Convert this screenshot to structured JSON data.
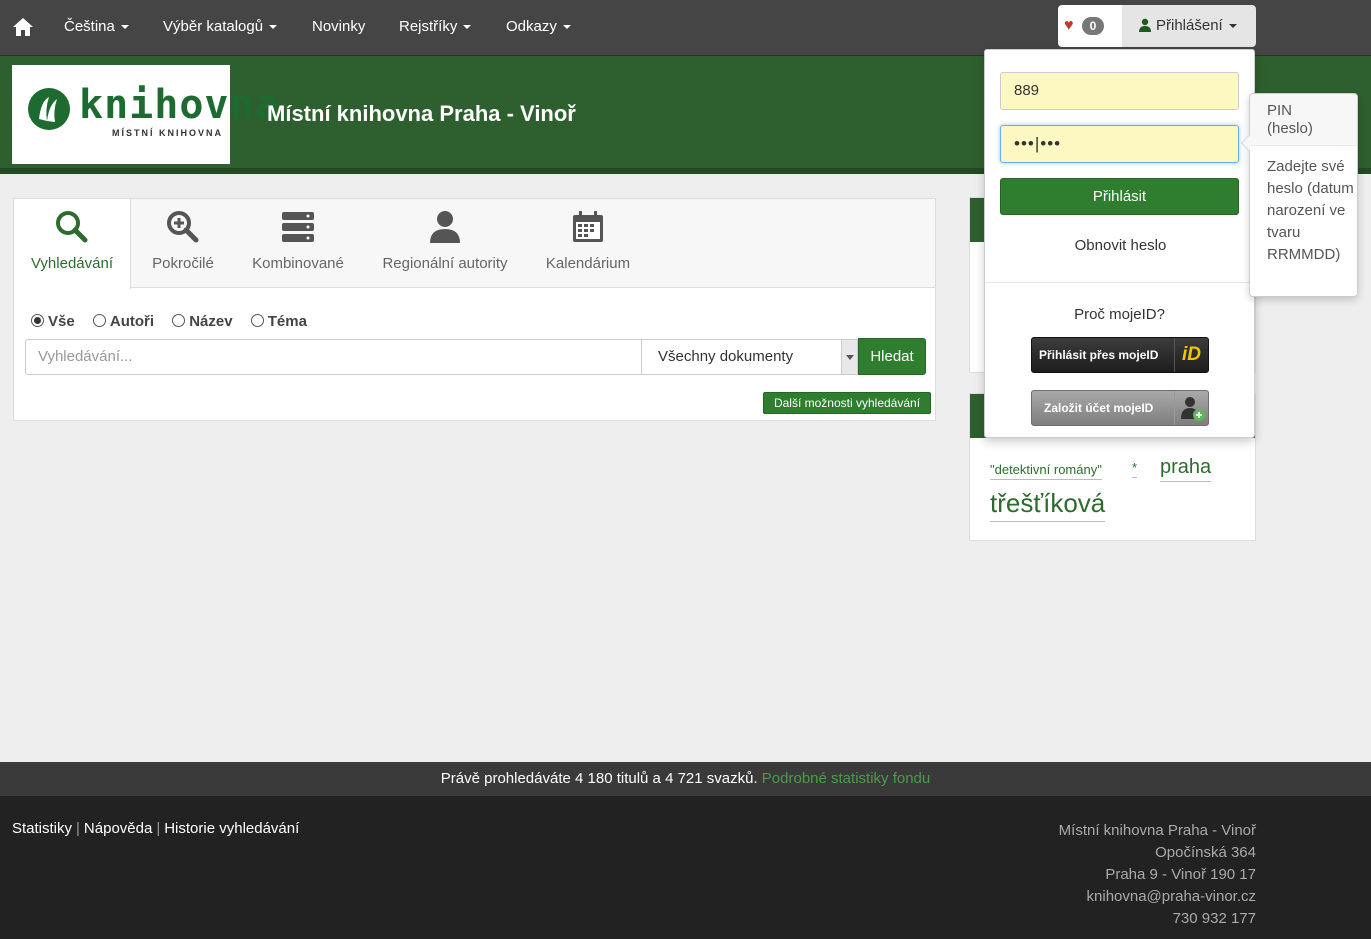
{
  "nav": {
    "items": [
      {
        "label": "Čeština",
        "dropdown": true
      },
      {
        "label": "Výběr katalogů",
        "dropdown": true
      },
      {
        "label": "Novinky",
        "dropdown": false
      },
      {
        "label": "Rejstříky",
        "dropdown": true
      },
      {
        "label": "Odkazy",
        "dropdown": true
      }
    ],
    "favorites_count": "0",
    "login_label": "Přihlášení"
  },
  "header": {
    "logo_word": "knihovna",
    "logo_sub": "MÍSTNÍ KNIHOVNA",
    "site_title": "Místní knihovna Praha - Vinoř"
  },
  "search": {
    "tabs": [
      "Vyhledávání",
      "Pokročilé",
      "Kombinované",
      "Regionální autority",
      "Kalendárium"
    ],
    "active_tab": "Vyhledávání",
    "radios": [
      "Vše",
      "Autoři",
      "Název",
      "Téma"
    ],
    "selected_radio": "Vše",
    "placeholder": "Vyhledávání...",
    "doc_type": "Všechny dokumenty",
    "submit": "Hledat",
    "more_options": "Další možnosti vyhledávání"
  },
  "tag_cloud": {
    "tags": [
      "\"detektivní romány\"",
      "*",
      "praha",
      "třešťíková"
    ]
  },
  "login": {
    "username_value": "889",
    "password_mask": "•••|•••",
    "submit": "Přihlásit",
    "renew": "Obnovit heslo",
    "why_mojeid": "Proč mojeID?",
    "mojeid_login": "Přihlásit přes mojeID",
    "mojeid_create": "Založit účet mojeID",
    "mojeid_logo": "iD"
  },
  "popover": {
    "title": "PIN (heslo)",
    "body": "Zadejte své heslo (datum narození ve tvaru RRMMDD)"
  },
  "stats": {
    "text": "Právě prohledáváte 4 180 titulů a 4 721 svazků.",
    "link": "Podrobné statistiky fondu"
  },
  "footer": {
    "links": [
      "Statistiky",
      "Nápověda",
      "Historie vyhledávání"
    ],
    "address": [
      "Místní knihovna Praha - Vinoř",
      "Opočínská 364",
      "Praha 9 - Vinoř 190 17",
      "knihovna@praha-vinor.cz",
      "730 932 177"
    ]
  },
  "colors": {
    "brand_green": "#2e5f2e",
    "button_green": "#2f7d2f",
    "field_yellow": "#fdf7c2"
  }
}
